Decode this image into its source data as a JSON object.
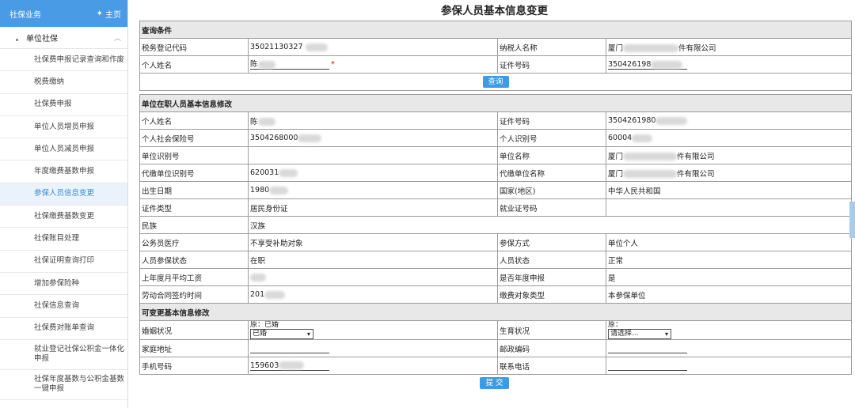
{
  "sidebar": {
    "header_title": "社保业务",
    "home_label": "主页",
    "section_title": "单位社保",
    "items": [
      {
        "label": "社保费申报记录查询和作废"
      },
      {
        "label": "税费缴纳"
      },
      {
        "label": "社保费申报"
      },
      {
        "label": "单位人员增员申报"
      },
      {
        "label": "单位人员减员申报"
      },
      {
        "label": "年度缴费基数申报"
      },
      {
        "label": "参保人员信息变更"
      },
      {
        "label": "社保缴费基数变更"
      },
      {
        "label": "社保账目处理"
      },
      {
        "label": "社保证明查询打印"
      },
      {
        "label": "增加参保险种"
      },
      {
        "label": "社保信息查询"
      },
      {
        "label": "社保费对账单查询"
      },
      {
        "label": "就业登记社保公积金一体化申报"
      },
      {
        "label": "社保年度基数与公积金基数一键申报"
      }
    ],
    "active_index": 6
  },
  "page": {
    "title": "参保人员基本信息变更"
  },
  "query": {
    "section_title": "查询条件",
    "tax_code_label": "税务登记代码",
    "tax_code_value": "35021130327",
    "taxpayer_label": "纳税人名称",
    "taxpayer_prefix": "厦门",
    "taxpayer_suffix": "件有限公司",
    "name_label": "个人姓名",
    "name_value": "陈",
    "name_required": "*",
    "id_label": "证件号码",
    "id_value": "350426198",
    "query_button": "查询"
  },
  "info": {
    "section_title": "单位在职人员基本信息修改",
    "rows": [
      {
        "l1": "个人姓名",
        "v1": "陈",
        "l2": "证件号码",
        "v2": "3504261980"
      },
      {
        "l1": "个人社会保险号",
        "v1": "3504268000",
        "l2": "个人识别号",
        "v2": "60004"
      },
      {
        "l1": "单位识别号",
        "v1": "",
        "l2": "单位名称",
        "v2": "厦门",
        "v2b": "件有限公司"
      },
      {
        "l1": "代缴单位识别号",
        "v1": "620031",
        "l2": "代缴单位名称",
        "v2": "厦门",
        "v2b": "件有限公司"
      },
      {
        "l1": "出生日期",
        "v1": "1980",
        "l2": "国家(地区)",
        "v2": "中华人民共和国"
      },
      {
        "l1": "证件类型",
        "v1": "居民身份证",
        "l2": "就业证号码",
        "v2": ""
      },
      {
        "l1": "民族",
        "v1": "汉族"
      },
      {
        "l1": "公务员医疗",
        "v1": "不享受补助对象",
        "l2": "参保方式",
        "v2": "单位个人"
      },
      {
        "l1": "人员参保状态",
        "v1": "在职",
        "l2": "人员状态",
        "v2": "正常"
      },
      {
        "l1": "上年度月平均工资",
        "v1": "",
        "l2": "是否年度申报",
        "v2": "是"
      },
      {
        "l1": "劳动合同签约时间",
        "v1": "201",
        "l2": "缴费对象类型",
        "v2": "本参保单位"
      }
    ]
  },
  "editable": {
    "section_title": "可变更基本信息修改",
    "marital_label": "婚姻状况",
    "marital_orig": "原：已婚",
    "marital_selected": "已婚",
    "birth_label": "生育状况",
    "birth_orig": "原：",
    "birth_selected": "请选择...",
    "address_label": "家庭地址",
    "postcode_label": "邮政编码",
    "phone_label": "手机号码",
    "phone_value": "159603",
    "contact_label": "联系电话",
    "submit_button": "提 交"
  },
  "colors": {
    "accent": "#4a9be6",
    "active_text": "#3889d4",
    "section_bg": "#e8e8e8"
  }
}
